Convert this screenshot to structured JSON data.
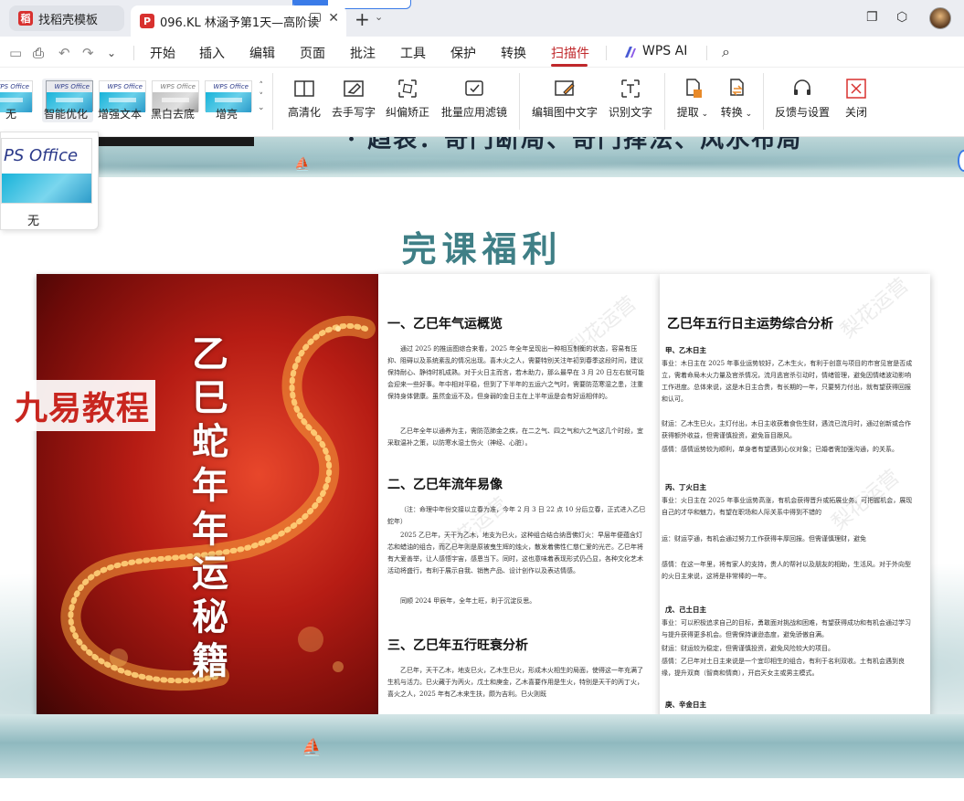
{
  "tabs": [
    {
      "label": "找稻壳模板"
    },
    {
      "label": "096.KL 林涵予第1天—高阶读"
    }
  ],
  "menu": {
    "items": [
      "开始",
      "插入",
      "编辑",
      "页面",
      "批注",
      "工具",
      "保护",
      "转换",
      "扫描件"
    ],
    "active": "扫描件",
    "wps_ai": "WPS AI",
    "accent": "#c0282b"
  },
  "ribbon": {
    "filters": [
      {
        "label": "无"
      },
      {
        "label": "智能优化"
      },
      {
        "label": "增强文本"
      },
      {
        "label": "黑白去底"
      },
      {
        "label": "增亮"
      }
    ],
    "thumb_text": "WPS Office",
    "buttons": {
      "clear": "高清化",
      "remove_handwriting": "去手写字",
      "deskew": "纠偏矫正",
      "batch_filter": "批量应用滤镜",
      "edit_image_text": "编辑图中文字",
      "ocr": "识别文字",
      "extract": "提取",
      "convert": "转换",
      "feedback": "反馈与设置",
      "close": "关闭"
    }
  },
  "popup": {
    "thumb_text": "PS Office",
    "label": "无"
  },
  "document": {
    "slogan": "· 趋表：奇门断局、奇门择法、风水布局",
    "heading": "完课福利",
    "cover": {
      "title": "乙巳蛇年年运秘籍",
      "stamp": "九易教程"
    },
    "page2": {
      "s1_title": "一、乙巳年气运概览",
      "s1_p1": "通过 2025 的推运图综合来看，2025 年全年呈现出一种相互制衡的状态，容易有压抑、阻碍以及系统紊乱的情况出现。喜木火之人，需要特别关注年初到春季这段时间，建议保持耐心、静待时机成熟。对于火日主而言，若木助力，那么最早在 3 月 20 日左右就可能会迎来一些好事。年中相对平稳，但到了下半年的五运六之气时，需要防范寒湿之患，注重保持身体健康。虽然金运不及，但身弱的金日主在上半年运是会有好运相伴的。",
      "s1_p2": "乙巳年全年以通养为主，需防范肺金之疾，在二之气、四之气和六之气这几个时段，宜采取温补之策，以防寒水湿土伤火（神经、心脏）。",
      "s2_title": "二、乙巳年流年易像",
      "s2_p1": "（注：命理中年份交接以立春为准，今年 2 月 3 日 22 点 10 分后立春，正式进入乙巳蛇年）",
      "s2_p2": "2025 乙巳年，天干为乙木，地支为巳火，这种组合结合纳音佛灯火：早层年便蕴含灯芯和蜡油的组合，而乙巳年则是原被曳生辉的烛火，散发着佛性仁慈仁爱的光芒。乙巳年将有大爱善举，让人感悟宇宙，感恩当下。同时，这也意味着表现形式仍凸显，各种文化艺术活动将盛行，有利于展示自我、销售产品、设计创作以及表达情感。",
      "s2_p3": "同顺 2024 甲辰年，全年土旺，利于沉淀反思。",
      "s3_title": "三、乙巳年五行旺衰分析",
      "s3_p1": "乙巳年，天干乙木，地支巳火，乙木生巳火，形成木火相生的局面，使得这一年充满了生机与活力。巳火藏于为丙火，戊土和庚金，乙木喜要作用是生火，特别是天干的丙丁火，喜火之人，2025 年有乙木来生扶，颇为吉利。巳火则既"
    },
    "page3": {
      "title": "乙巳年五行日主运势综合分析",
      "sub1": "甲、乙木日主",
      "p1": "事业：木日主在 2025 年事业运势较好，乙木生火，有利于创意与项目的市官见官是否成立，需着命局木火力量及官杀情况，流月逃官杀引动时，情绪管理，避免因情绪波动影响工作进度。总体来说，这是木日主合贵，有长期的一年，只要努力付出，就有望获得回报和认可。",
      "p2": "财运：乙木生巳火，主灯付出，木日主收获着食伤生财，遇流已流月时，通过创新或合作获得额外收益，但需谨慎投资，避免盲目跟风。",
      "p3": "感情：感情运势较为顺利，单身者有望遇到心仪对象；已婚者需加强沟通，的关系。",
      "sub2": "丙、丁火日主",
      "p4": "事业：火日主在 2025 年事业运势高涨，有机会获得晋升或拓展业务。可把握机会，展现自己的才华和魅力，有望在职场和人际关系中得到不错的",
      "p5": "运：财运亨通，有机会通过努力工作获得丰厚回报。但需谨慎理财，避免",
      "p6": "感情：在这一年里，将有家人的支持，贵人的帮衬以及朋友的相助，生活风。对于外向型的火日主来说，这将是非常棒的一年。",
      "sub3": "戊、己土日主",
      "p7": "事业：可以积极追求自己的目标，勇敢面对挑战和困难，有望获得成功和有机会通过学习与提升获得更多机会。但需保持谦逊态度，避免骄傲自满。",
      "p8": "财运：财运较为稳定，但需谨慎投资，避免风险较大的项目。",
      "p9": "感情：乙巳年对土日主来说是一个宜印相生的组合，有利于名利双收。土有机会遇到良缘，提升双商（智商和情商），开启天女主或男主模式。",
      "sub4": "庚、辛金日主"
    },
    "watermark": "梨花运营"
  }
}
